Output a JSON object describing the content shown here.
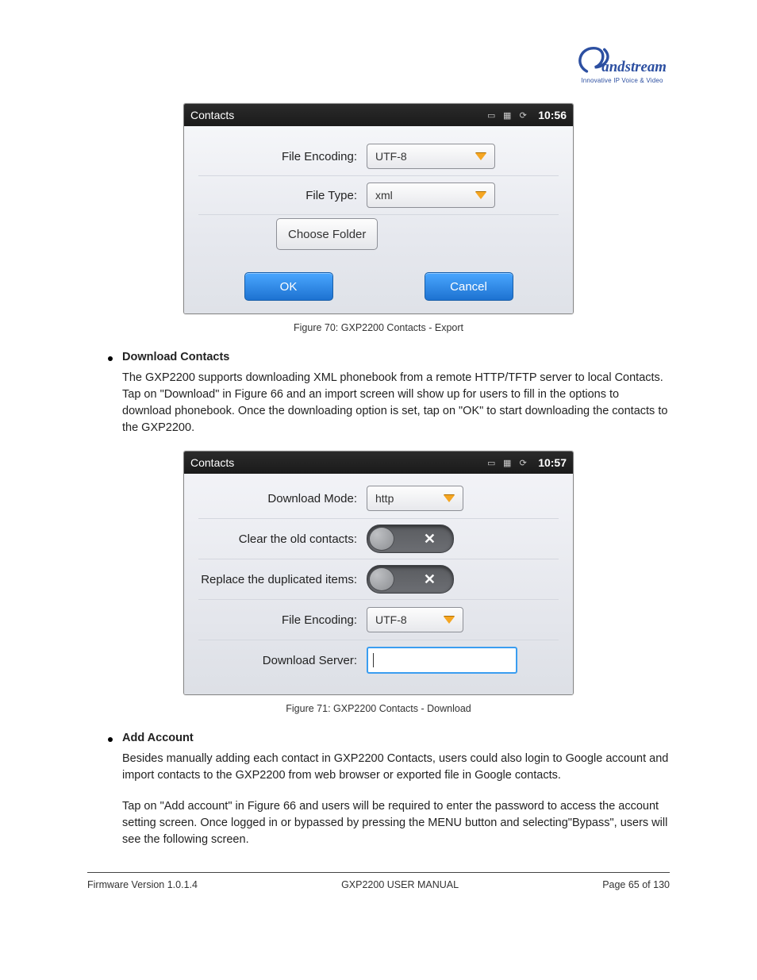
{
  "logo": {
    "word": "Grandstream",
    "sub": "Innovative IP Voice & Video"
  },
  "fig1": {
    "title": "Contacts",
    "time": "10:56",
    "labels": {
      "encoding": "File Encoding:",
      "type": "File Type:"
    },
    "values": {
      "encoding": "UTF-8",
      "type": "xml"
    },
    "choose": "Choose Folder",
    "ok": "OK",
    "cancel": "Cancel",
    "caption": "Figure 70: GXP2200 Contacts - Export"
  },
  "sec1": {
    "head": "Download Contacts",
    "body": "The GXP2200 supports downloading XML phonebook from a remote HTTP/TFTP server to local Contacts. Tap on \"Download\" in Figure 66 and an import screen will show up for users to fill in the options to download phonebook. Once the downloading option is set, tap on \"OK\" to start downloading the contacts to the GXP2200."
  },
  "fig2": {
    "title": "Contacts",
    "time": "10:57",
    "labels": {
      "mode": "Download Mode:",
      "clear": "Clear the old contacts:",
      "replace": "Replace the duplicated items:",
      "encoding": "File Encoding:",
      "server": "Download Server:"
    },
    "values": {
      "mode": "http",
      "encoding": "UTF-8",
      "server": ""
    },
    "caption": "Figure 71: GXP2200 Contacts - Download"
  },
  "sec2": {
    "head": "Add Account",
    "body1": "Besides manually adding each contact in GXP2200 Contacts, users could also login to Google account and import contacts to the GXP2200 from web browser or exported file in Google contacts.",
    "body2": "Tap on \"Add account\" in Figure 66 and users will be required to enter the password to access the account setting screen. Once logged in or bypassed by pressing the MENU button and selecting\"Bypass\", users will see the following screen."
  },
  "footer": {
    "left": "Firmware Version 1.0.1.4",
    "center": "GXP2200 USER MANUAL",
    "right": "Page 65 of 130"
  }
}
